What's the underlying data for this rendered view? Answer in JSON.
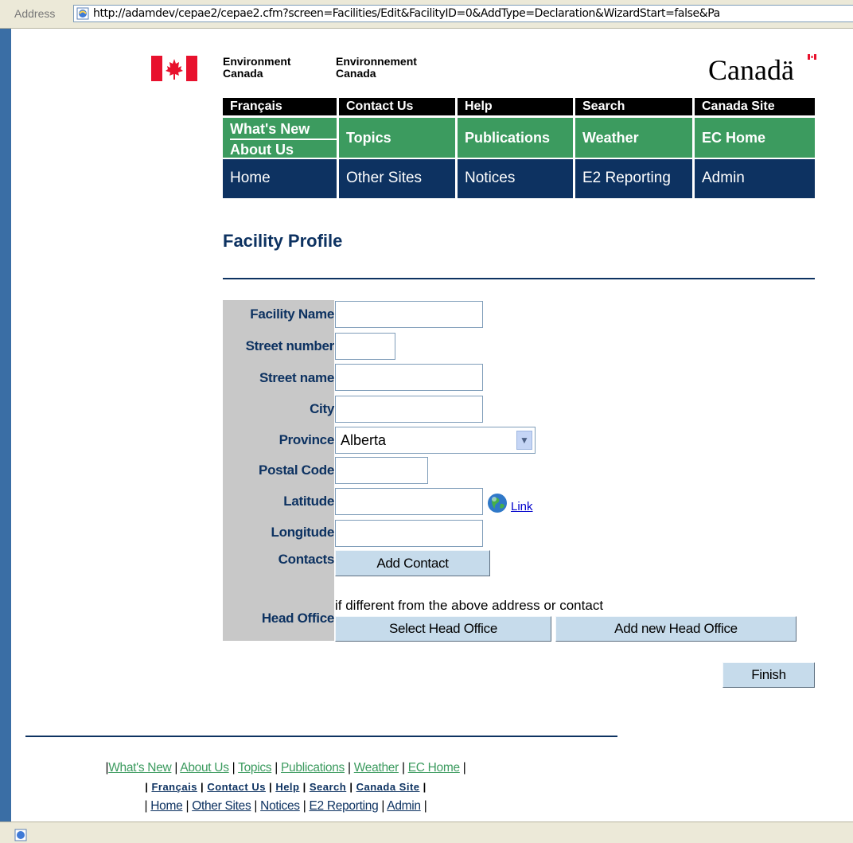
{
  "browser": {
    "address_label": "Address",
    "url": "http://adamdev/cepae2/cepae2.cfm?screen=Facilities/Edit&FacilityID=0&AddType=Declaration&WizardStart=false&Pa"
  },
  "header": {
    "dept_en_line1": "Environment",
    "dept_en_line2": "Canada",
    "dept_fr_line1": "Environnement",
    "dept_fr_line2": "Canada",
    "wordmark": "Canadä"
  },
  "nav": {
    "black": [
      "Français",
      "Contact Us",
      "Help",
      "Search",
      "Canada Site"
    ],
    "green": [
      "What's New",
      "About Us",
      "Topics",
      "Publications",
      "Weather",
      "EC Home"
    ],
    "blue": [
      "Home",
      "Other Sites",
      "Notices",
      "E2 Reporting",
      "Admin"
    ]
  },
  "page": {
    "title": "Facility Profile"
  },
  "form": {
    "labels": {
      "facility_name": "Facility Name",
      "street_number": "Street number",
      "street_name": "Street name",
      "city": "City",
      "province": "Province",
      "postal_code": "Postal Code",
      "latitude": "Latitude",
      "longitude": "Longitude",
      "contacts": "Contacts",
      "head_office": "Head Office"
    },
    "values": {
      "facility_name": "",
      "street_number": "",
      "street_name": "",
      "city": "",
      "province": "Alberta",
      "postal_code": "",
      "latitude": "",
      "longitude": ""
    },
    "map_link": "Link",
    "add_contact_button": "Add Contact",
    "head_office_note": "if different from the above address or contact",
    "select_head_office_button": "Select Head Office",
    "add_head_office_button": "Add new Head Office",
    "finish_button": "Finish"
  },
  "footer": {
    "row1": [
      "What's New",
      "About Us",
      "Topics",
      "Publications",
      "Weather",
      "EC Home"
    ],
    "row2": [
      "Français",
      "Contact Us",
      "Help",
      "Search",
      "Canada Site"
    ],
    "row3": [
      "Home",
      "Other Sites",
      "Notices",
      "E2 Reporting",
      "Admin"
    ]
  },
  "colors": {
    "navy": "#0d3261",
    "green": "#3c9b5f",
    "label_bg": "#c8c8c8",
    "button_bg": "#c6dbeb"
  }
}
